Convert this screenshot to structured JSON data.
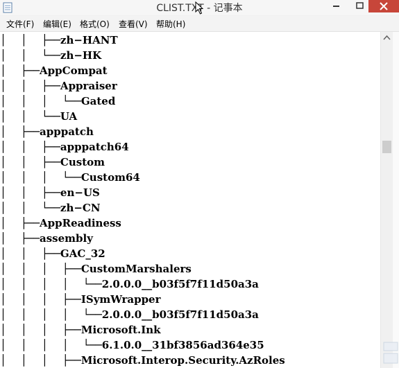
{
  "window": {
    "title": "CLIST.TXT - 记事本"
  },
  "menu": [
    {
      "label": "文件(F)"
    },
    {
      "label": "编辑(E)"
    },
    {
      "label": "格式(O)"
    },
    {
      "label": "查看(V)"
    },
    {
      "label": "帮助(H)"
    }
  ],
  "lines": [
    "│    │    ├──zh−HANT",
    "│    │    └──zh−HK",
    "│    ├──AppCompat",
    "│    │    ├──Appraiser",
    "│    │    │    └──Gated",
    "│    │    └──UA",
    "│    ├──apppatch",
    "│    │    ├──apppatch64",
    "│    │    ├──Custom",
    "│    │    │    └──Custom64",
    "│    │    ├──en−US",
    "│    │    └──zh−CN",
    "│    ├──AppReadiness",
    "│    ├──assembly",
    "│    │    ├──GAC_32",
    "│    │    │    ├──CustomMarshalers",
    "│    │    │    │    └──2.0.0.0__b03f5f7f11d50a3a",
    "│    │    │    ├──ISymWrapper",
    "│    │    │    │    └──2.0.0.0__b03f5f7f11d50a3a",
    "│    │    │    ├──Microsoft.Ink",
    "│    │    │    │    └──6.1.0.0__31bf3856ad364e35",
    "│    │    │    ├──Microsoft.Interop.Security.AzRoles"
  ],
  "colors": {
    "close": "#c7463a",
    "thumb": "#cdcdcd"
  },
  "icons": [
    "notepad-icon",
    "cursor-icon",
    "minimize-icon",
    "maximize-icon",
    "close-icon",
    "scroll-up-icon"
  ]
}
